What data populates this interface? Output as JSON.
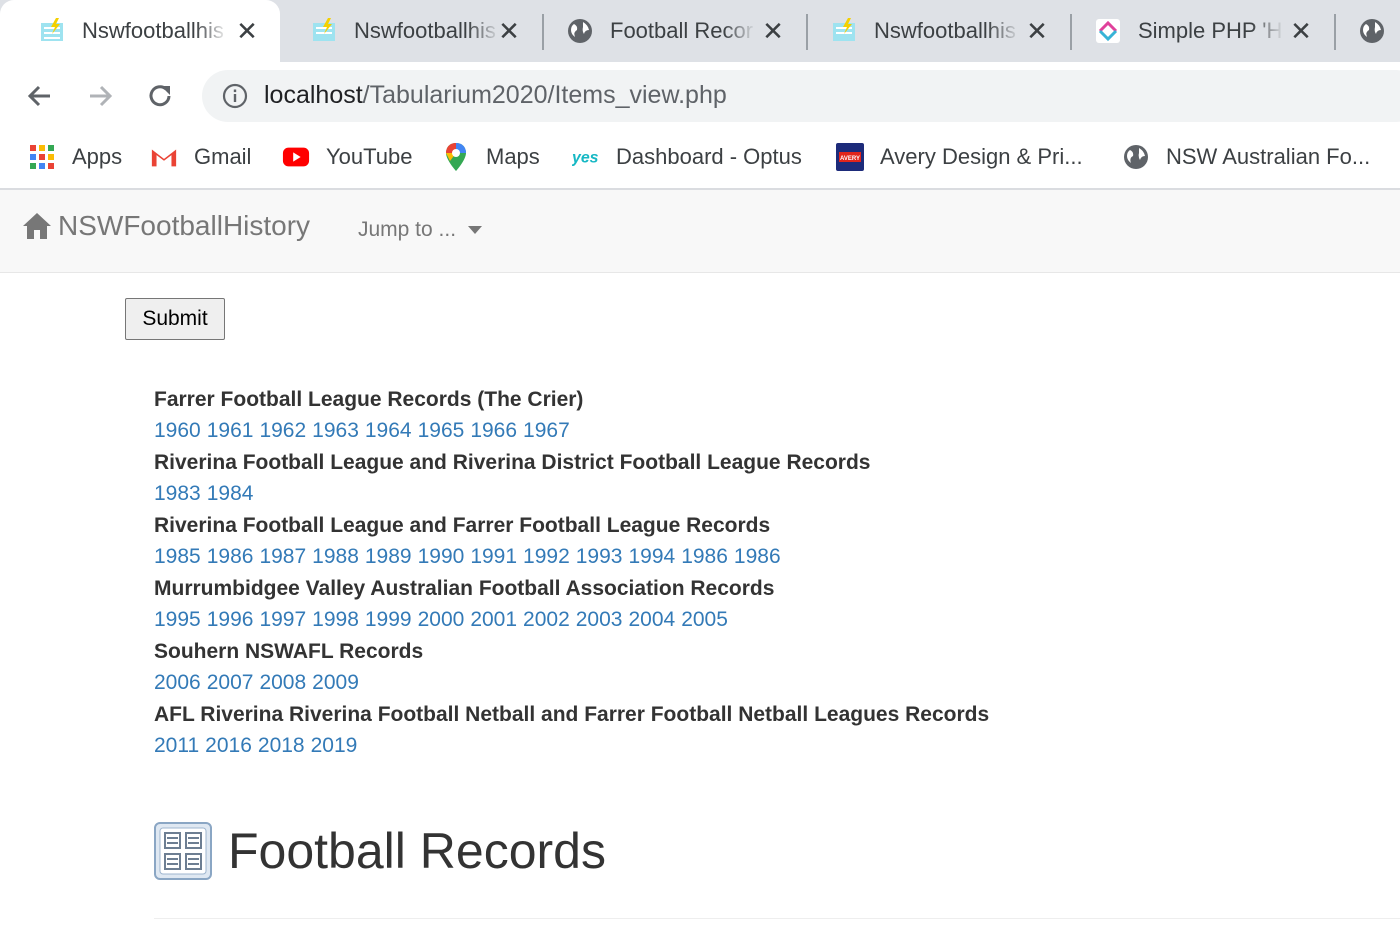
{
  "browser": {
    "tabs": [
      {
        "title": "Nswfootballhis",
        "icon": "lightning-page-icon",
        "active": true
      },
      {
        "title": "Nswfootballhis",
        "icon": "lightning-page-icon",
        "active": false
      },
      {
        "title": "Football Recor",
        "icon": "globe-icon",
        "active": false
      },
      {
        "title": "Nswfootballhis",
        "icon": "lightning-page-icon",
        "active": false
      },
      {
        "title": "Simple PHP 'H",
        "icon": "php-icon",
        "active": false
      }
    ],
    "url_host": "localhost",
    "url_path": "/Tabularium2020/Items_view.php",
    "bookmarks": [
      {
        "label": "Apps",
        "icon": "apps-grid-icon"
      },
      {
        "label": "Gmail",
        "icon": "gmail-icon"
      },
      {
        "label": "YouTube",
        "icon": "youtube-icon"
      },
      {
        "label": "Maps",
        "icon": "maps-pin-icon"
      },
      {
        "label": "Dashboard - Optus",
        "icon": "yes-optus-icon"
      },
      {
        "label": "Avery Design & Pri...",
        "icon": "avery-icon"
      },
      {
        "label": "NSW Australian Fo...",
        "icon": "globe-icon"
      }
    ]
  },
  "navbar": {
    "brand": "NSWFootballHistory",
    "jump_to": "Jump to ..."
  },
  "form": {
    "submit_label": "Submit"
  },
  "records": [
    {
      "title": "Farrer Football League Records (The Crier)",
      "years": [
        "1960",
        "1961",
        "1962",
        "1963",
        "1964",
        "1965",
        "1966",
        "1967"
      ]
    },
    {
      "title": "Riverina Football League and Riverina District Football League Records",
      "years": [
        "1983",
        "1984"
      ]
    },
    {
      "title": "Riverina Football League and Farrer Football League Records",
      "years": [
        "1985",
        "1986",
        "1987",
        "1988",
        "1989",
        "1990",
        "1991",
        "1992",
        "1993",
        "1994",
        "1986",
        "1986"
      ]
    },
    {
      "title": "Murrumbidgee Valley Australian Football Association Records",
      "years": [
        "1995",
        "1996",
        "1997",
        "1998",
        "1999",
        "2000",
        "2001",
        "2002",
        "2003",
        "2004",
        "2005"
      ]
    },
    {
      "title": "Souhern NSWAFL Records",
      "years": [
        "2006",
        "2007",
        "2008",
        "2009"
      ]
    },
    {
      "title": "AFL Riverina Riverina Football Netball and Farrer Football Netball Leagues Records",
      "years": [
        "2011",
        "2016",
        "2018",
        "2019"
      ]
    }
  ],
  "page": {
    "heading": "Football Records"
  },
  "colors": {
    "link": "#337ab7",
    "tabstrip": "#dee1e6",
    "navbar": "#f8f8f8"
  }
}
